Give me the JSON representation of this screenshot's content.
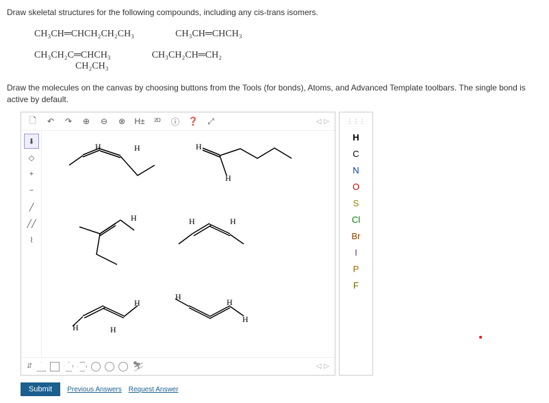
{
  "question": "Draw skeletal structures for the following compounds, including any cis-​trans isomers.",
  "formulas": {
    "f1": "CH₃CH═CHCH₂CH₂CH₃",
    "f2": "CH₃CH═CHCH₃",
    "f3_top": "CH₃CH₂C═CHCH₃",
    "f3_bot": "CH₂CH₃",
    "f4": "CH₃CH₂CH═CH₂"
  },
  "instruction": "Draw the molecules on the canvas by choosing buttons from the Tools (for bonds), Atoms, and Advanced Template toolbars. The single bond is active by default.",
  "top_toolbar": {
    "new": "🗋",
    "undo": "↶",
    "redo": "↷",
    "zoom_in": "⊕",
    "zoom_out": "⊖",
    "fit": "⊗",
    "h_toggle": "H±",
    "view_2d": "²ᴰ",
    "info": "ⓘ",
    "help": "❓",
    "expand": "⤢"
  },
  "left_toolbar": {
    "move": "⬇",
    "erase": "◇",
    "plus": "+",
    "minus": "−",
    "single": "╱",
    "double": "╱╱",
    "chain": "⌇"
  },
  "atoms": {
    "periodic": "⋮⋮⋮",
    "H": "H",
    "C": "C",
    "N": "N",
    "O": "O",
    "S": "S",
    "Cl": "Cl",
    "Br": "Br",
    "I": "I",
    "P": "P",
    "F": "F"
  },
  "bottom": {
    "submit": "Submit",
    "prev": "Previous Answers",
    "req": "Request Answer"
  },
  "nav": {
    "left": "◁",
    "right": "▷"
  },
  "h_labels": [
    "H",
    "H",
    "H",
    "H",
    "H",
    "H",
    "H",
    "H",
    "H",
    "H",
    "H",
    "H",
    "H"
  ]
}
